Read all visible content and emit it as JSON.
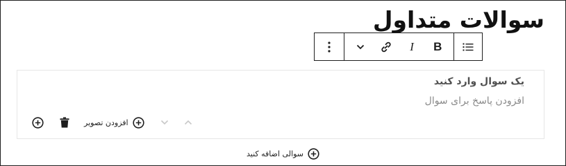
{
  "page_title": "سوالات متداول",
  "toolbar": {
    "bold_label": "B",
    "italic_label": "I"
  },
  "faq": {
    "question_placeholder": "یک سوال وارد کنید",
    "answer_placeholder": "افزودن پاسخ برای سوال",
    "add_image_label": "افزودن تصویر"
  },
  "add_question_label": "سوالی اضافه کنید",
  "colors": {
    "border": "#1e1e1e",
    "block_border": "#e6e6e6",
    "muted_chevron": "#c8c8c8",
    "answer_text": "#8a8a8a"
  }
}
